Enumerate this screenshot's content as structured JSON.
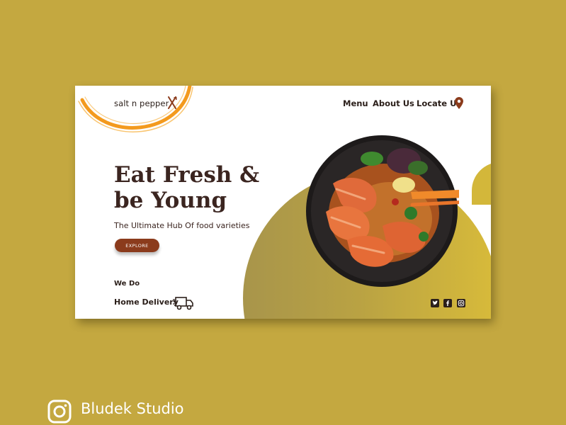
{
  "brand": {
    "name": "salt n pepper",
    "icon": "fork-knife-icon"
  },
  "nav": {
    "items": [
      {
        "label": "Menu"
      },
      {
        "label": "About Us"
      },
      {
        "label": "Locate Us",
        "icon": "location-pin-icon"
      }
    ]
  },
  "hero": {
    "title": "Eat Fresh & be Young",
    "subtitle": "The Ultimate Hub Of food varieties",
    "cta_label": "EXPLORE"
  },
  "services": {
    "heading": "We Do",
    "item": "Home Delivery",
    "icon": "delivery-truck-icon"
  },
  "social": [
    "twitter-icon",
    "facebook-icon",
    "instagram-icon"
  ],
  "studio": {
    "name": "Bludek Studio",
    "icon": "instagram-icon"
  },
  "colors": {
    "background": "#c4a840",
    "accent": "#8b3b1c",
    "ring": "#f39a1e",
    "text": "#3b2520"
  }
}
